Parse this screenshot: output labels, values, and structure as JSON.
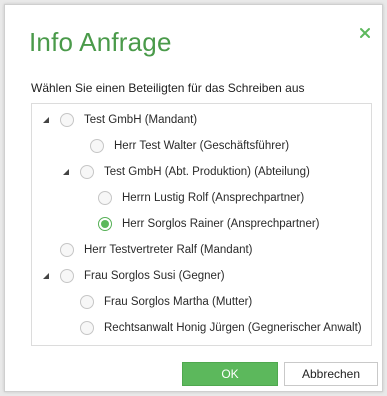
{
  "dialog": {
    "title": "Info Anfrage",
    "subtitle": "Wählen Sie einen Beteiligten für das Schreiben aus",
    "close_icon": "close-x-icon",
    "accent_color": "#5cb85c"
  },
  "tree": {
    "nodes": [
      {
        "label": "Test GmbH  (Mandant)",
        "level": 0,
        "expandable": true,
        "expanded": true,
        "selected": false
      },
      {
        "label": "Herr Test Walter (Geschäftsführer)",
        "level": 1,
        "expandable": false,
        "selected": false
      },
      {
        "label": "Test GmbH (Abt. Produktion)  (Abteilung)",
        "level": 1,
        "expandable": true,
        "expanded": true,
        "selected": false
      },
      {
        "label": "Herrn Lustig Rolf (Ansprechpartner)",
        "level": 2,
        "expandable": false,
        "selected": false
      },
      {
        "label": "Herr Sorglos Rainer (Ansprechpartner)",
        "level": 2,
        "expandable": false,
        "selected": true
      },
      {
        "label": "Herr Testvertreter Ralf (Mandant)",
        "level": 0,
        "expandable": false,
        "selected": false
      },
      {
        "label": "Frau Sorglos Susi (Gegner)",
        "level": 0,
        "expandable": true,
        "expanded": true,
        "selected": false
      },
      {
        "label": "Frau Sorglos Martha (Mutter)",
        "level": 1,
        "expandable": false,
        "selected": false
      },
      {
        "label": "Rechtsanwalt Honig Jürgen (Gegnerischer Anwalt)",
        "level": 1,
        "expandable": false,
        "selected": false
      }
    ]
  },
  "buttons": {
    "ok_label": "OK",
    "cancel_label": "Abbrechen"
  }
}
